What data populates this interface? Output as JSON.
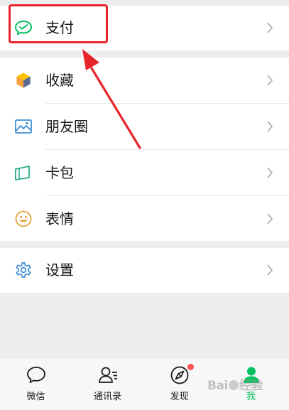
{
  "menu": {
    "pay": {
      "label": "支付",
      "icon": "wechat-pay-icon"
    },
    "favorites": {
      "label": "收藏",
      "icon": "cube-icon"
    },
    "moments": {
      "label": "朋友圈",
      "icon": "image-icon"
    },
    "cards": {
      "label": "卡包",
      "icon": "card-icon"
    },
    "stickers": {
      "label": "表情",
      "icon": "smiley-icon"
    },
    "settings": {
      "label": "设置",
      "icon": "gear-icon"
    }
  },
  "tabbar": {
    "tabs": [
      {
        "label": "微信",
        "icon": "chat-bubble-icon",
        "active": false
      },
      {
        "label": "通讯录",
        "icon": "contacts-icon",
        "active": false
      },
      {
        "label": "发现",
        "icon": "compass-icon",
        "active": false,
        "badge": true
      },
      {
        "label": "我",
        "icon": "person-icon",
        "active": true
      }
    ]
  },
  "watermark": {
    "text_left": "Bai",
    "text_right": "经验"
  },
  "colors": {
    "accent_green": "#07c160",
    "annotation_red": "#e8242a",
    "badge_red": "#fa5151",
    "background": "#ededed"
  }
}
